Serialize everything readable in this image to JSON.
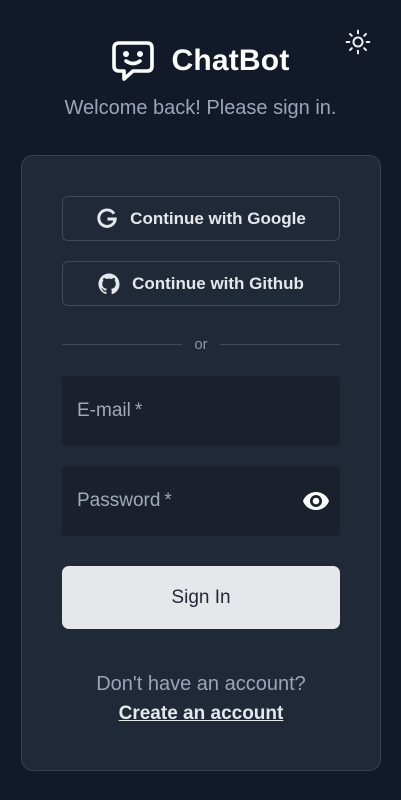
{
  "brand": {
    "title": "ChatBot",
    "logo_icon": "chat-smile-icon"
  },
  "header": {
    "theme_toggle_icon": "sun-icon"
  },
  "subtitle": "Welcome back! Please sign in.",
  "oauth": {
    "google": {
      "label": "Continue with Google",
      "icon": "google-icon"
    },
    "github": {
      "label": "Continue with Github",
      "icon": "github-icon"
    }
  },
  "divider": {
    "label": "or"
  },
  "form": {
    "email": {
      "label": "E-mail",
      "required_mark": "*"
    },
    "password": {
      "label": "Password",
      "required_mark": "*",
      "toggle_icon": "eye-icon"
    },
    "submit_label": "Sign In"
  },
  "footer": {
    "prompt": "Don't have an account?",
    "link_label": "Create an account"
  },
  "colors": {
    "background": "#121a29",
    "card": "#1f2937",
    "primary_button": "#e5e7eb",
    "text_muted": "#9aa5b8"
  }
}
